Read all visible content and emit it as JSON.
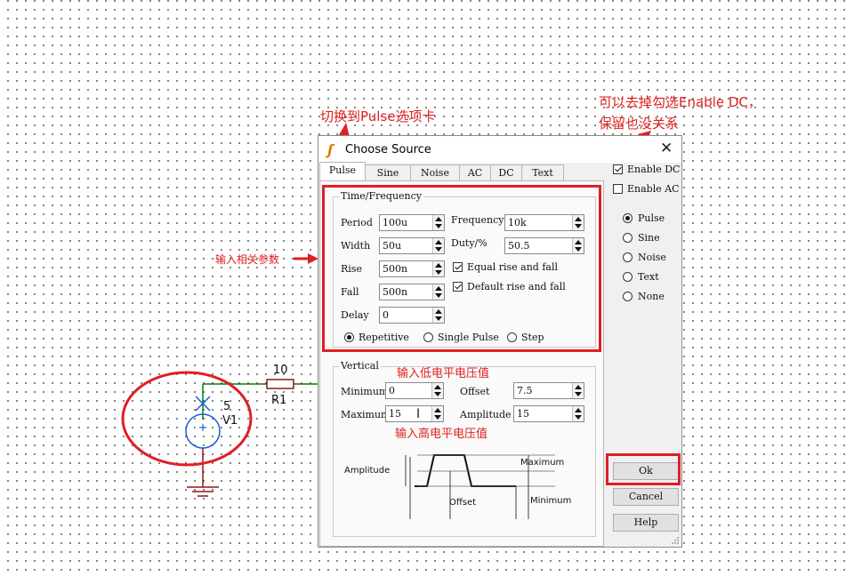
{
  "annotations": {
    "tab_hint": "切换到Pulse选项卡",
    "enable_dc_hint_1": "可以去掉勾选Enable DC，",
    "enable_dc_hint_2": "保留也没关系",
    "params_hint": "输入相关参数",
    "low_hint": "输入低电平电压值",
    "high_hint": "输入高电平电压值"
  },
  "schematic": {
    "resistor_value": "10",
    "resistor_name": "R1",
    "source_value": "5",
    "source_name": "V1"
  },
  "dialog": {
    "title": "Choose Source",
    "close": "✕",
    "tabs": [
      "Pulse",
      "Sine",
      "Noise",
      "AC",
      "DC",
      "Text"
    ],
    "active_tab": "Pulse",
    "time_group": {
      "label": "Time/Frequency",
      "period_label": "Period",
      "period": "100u",
      "width_label": "Width",
      "width": "50u",
      "rise_label": "Rise",
      "rise": "500n",
      "fall_label": "Fall",
      "fall": "500n",
      "delay_label": "Delay",
      "delay": "0",
      "frequency_label": "Frequency",
      "frequency": "10k",
      "duty_label": "Duty/%",
      "duty": "50.5",
      "equal_label": "Equal rise and fall",
      "equal_checked": true,
      "default_label": "Default rise and fall",
      "default_checked": true,
      "mode_repetitive": "Repetitive",
      "mode_single": "Single Pulse",
      "mode_step": "Step",
      "selected_mode": "Repetitive"
    },
    "vertical_group": {
      "label": "Vertical",
      "minimum_label": "Minimum",
      "minimum": "0",
      "maximum_label": "Maximum",
      "maximum": "15",
      "offset_label": "Offset",
      "offset": "7.5",
      "amplitude_label": "Amplitude",
      "amplitude": "15",
      "diagram_amplitude": "Amplitude",
      "diagram_offset": "Offset",
      "diagram_maximum": "Maximum",
      "diagram_minimum": "Minimum"
    },
    "enable_dc": {
      "label": "Enable DC",
      "checked": true
    },
    "enable_ac": {
      "label": "Enable AC",
      "checked": false
    },
    "source_types": [
      "Pulse",
      "Sine",
      "Noise",
      "Text",
      "None"
    ],
    "selected_type": "Pulse",
    "ok_label": "Ok",
    "cancel_label": "Cancel",
    "help_label": "Help"
  },
  "colors": {
    "annotation_red": "#e01f26",
    "wire_green": "#0a7a0a",
    "source_blue": "#1560d8"
  }
}
